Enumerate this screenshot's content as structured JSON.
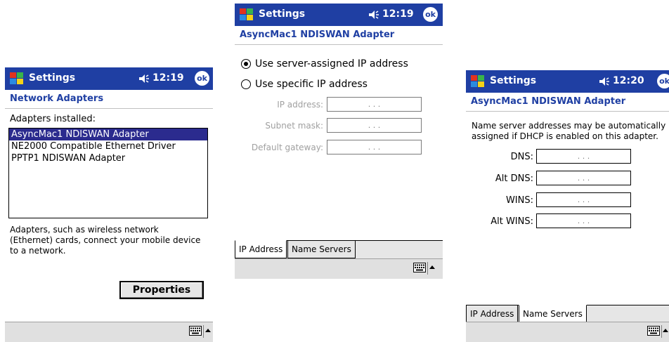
{
  "phone1": {
    "titlebar": {
      "app_title": "Settings",
      "time": "12:19",
      "ok_label": "ok"
    },
    "page_title": "Network Adapters",
    "adapters_label": "Adapters installed:",
    "adapters": [
      {
        "label": "AsyncMac1 NDISWAN Adapter",
        "selected": true
      },
      {
        "label": "NE2000 Compatible Ethernet Driver",
        "selected": false
      },
      {
        "label": "PPTP1 NDISWAN Adapter",
        "selected": false
      }
    ],
    "description": "Adapters, such as wireless network (Ethernet) cards, connect your mobile device to a network.",
    "properties_button": "Properties"
  },
  "phone2": {
    "titlebar": {
      "app_title": "Settings",
      "time": "12:19",
      "ok_label": "ok"
    },
    "page_title": "AsyncMac1 NDISWAN Adapter",
    "radio_server": "Use server-assigned IP address",
    "radio_specific": "Use specific IP address",
    "ip_label": "IP address:",
    "subnet_label": "Subnet mask:",
    "gateway_label": "Default gateway:",
    "tabs": [
      "IP Address",
      "Name Servers"
    ]
  },
  "phone3": {
    "titlebar": {
      "app_title": "Settings",
      "time": "12:20",
      "ok_label": "ok"
    },
    "page_title": "AsyncMac1 NDISWAN Adapter",
    "description": "Name server addresses may be automatically assigned if DHCP is enabled on this adapter.",
    "dns_label": "DNS:",
    "alt_dns_label": "Alt DNS:",
    "wins_label": "WINS:",
    "alt_wins_label": "Alt WINS:",
    "tabs": [
      "IP Address",
      "Name Servers"
    ]
  },
  "ip_dots": ".    .    .",
  "colors": {
    "titlebar": "#1f3fa3",
    "selection": "#2b2b8e",
    "cmdbar": "#e0e0e0"
  }
}
